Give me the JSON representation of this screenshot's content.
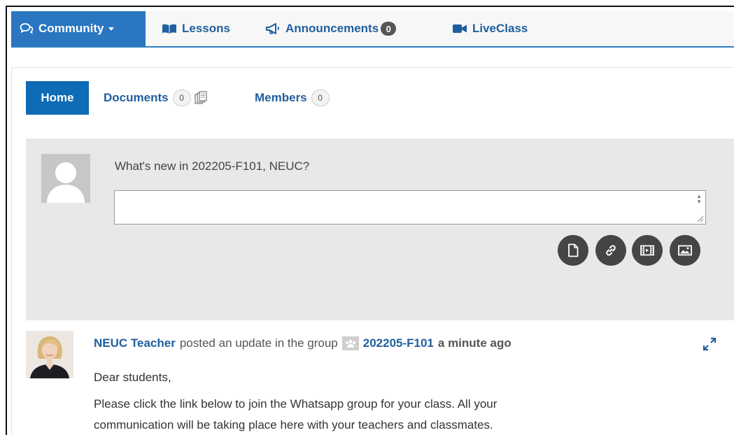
{
  "nav": {
    "community": "Community",
    "lessons": "Lessons",
    "announcements": "Announcements",
    "announcements_count": "0",
    "liveclass": "LiveClass"
  },
  "subnav": {
    "home": "Home",
    "documents": "Documents",
    "documents_count": "0",
    "members": "Members",
    "members_count": "0"
  },
  "composer": {
    "prompt": "What's new in 202205-F101, NEUC?",
    "value": "",
    "attachments": [
      "document-icon",
      "link-icon",
      "video-icon",
      "image-icon"
    ]
  },
  "activity": {
    "author": "NEUC Teacher",
    "action": "posted an update in the group",
    "group": "202205-F101",
    "time": "a minute ago",
    "lines": [
      "Dear students,",
      "Please click the link below to join the Whatsapp group for your class. All your",
      "communication will be taking place here with your teachers and classmates."
    ]
  },
  "colors": {
    "primary": "#2a76c0",
    "link": "#1f5f9e",
    "composer_bg": "#e8e8e8",
    "attach_btn": "#454545"
  }
}
